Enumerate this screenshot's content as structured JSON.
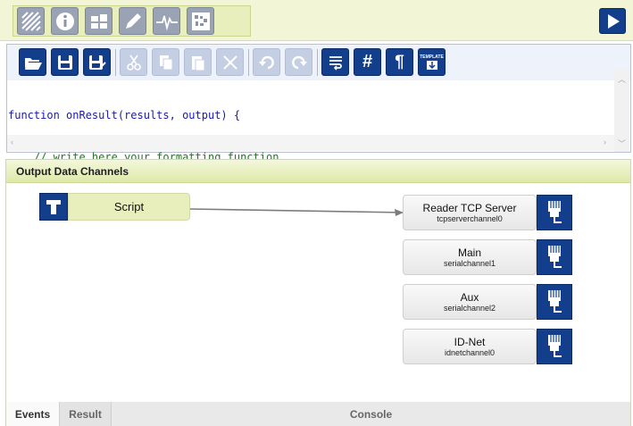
{
  "editor": {
    "code_line1": "function onResult(results, output) {",
    "code_line2": "    // write here your formatting function",
    "code_line3": "}"
  },
  "panel": {
    "title": "Output Data Channels",
    "script_label": "Script"
  },
  "channels": [
    {
      "name": "Reader TCP Server",
      "id": "tcpserverchannel0"
    },
    {
      "name": "Main",
      "id": "serialchannel1"
    },
    {
      "name": "Aux",
      "id": "serialchannel2"
    },
    {
      "name": "ID-Net",
      "id": "idnetchannel0"
    }
  ],
  "tabs": {
    "events": "Events",
    "result": "Result",
    "console": "Console"
  },
  "toolbar": {
    "editor_icon_hash": "#",
    "editor_icon_pilcrow": "¶",
    "editor_icon_template": "TEMPLATE"
  },
  "colors": {
    "accent": "#133e8c",
    "panel_header": "#dfe9a8",
    "toolbar_bg": "#f3f6d6"
  }
}
